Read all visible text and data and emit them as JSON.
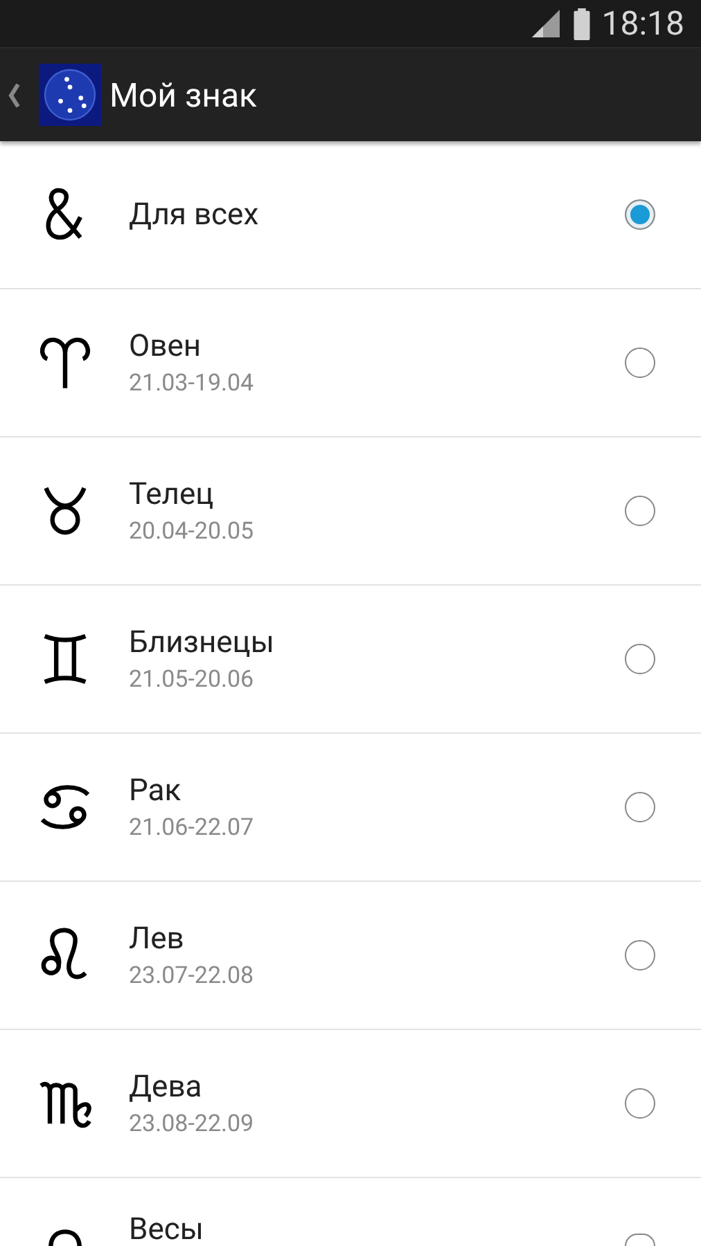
{
  "status_bar": {
    "time": "18:18"
  },
  "action_bar": {
    "title": "Мой знак"
  },
  "signs": [
    {
      "kind": "all",
      "name": "Для всех",
      "selected": true
    },
    {
      "kind": "aries",
      "name": "Овен",
      "dates": "21.03-19.04",
      "selected": false
    },
    {
      "kind": "taurus",
      "name": "Телец",
      "dates": "20.04-20.05",
      "selected": false
    },
    {
      "kind": "gemini",
      "name": "Близнецы",
      "dates": "21.05-20.06",
      "selected": false
    },
    {
      "kind": "cancer",
      "name": "Рак",
      "dates": "21.06-22.07",
      "selected": false
    },
    {
      "kind": "leo",
      "name": "Лев",
      "dates": "23.07-22.08",
      "selected": false
    },
    {
      "kind": "virgo",
      "name": "Дева",
      "dates": "23.08-22.09",
      "selected": false
    },
    {
      "kind": "libra",
      "name": "Весы",
      "selected": false
    }
  ]
}
